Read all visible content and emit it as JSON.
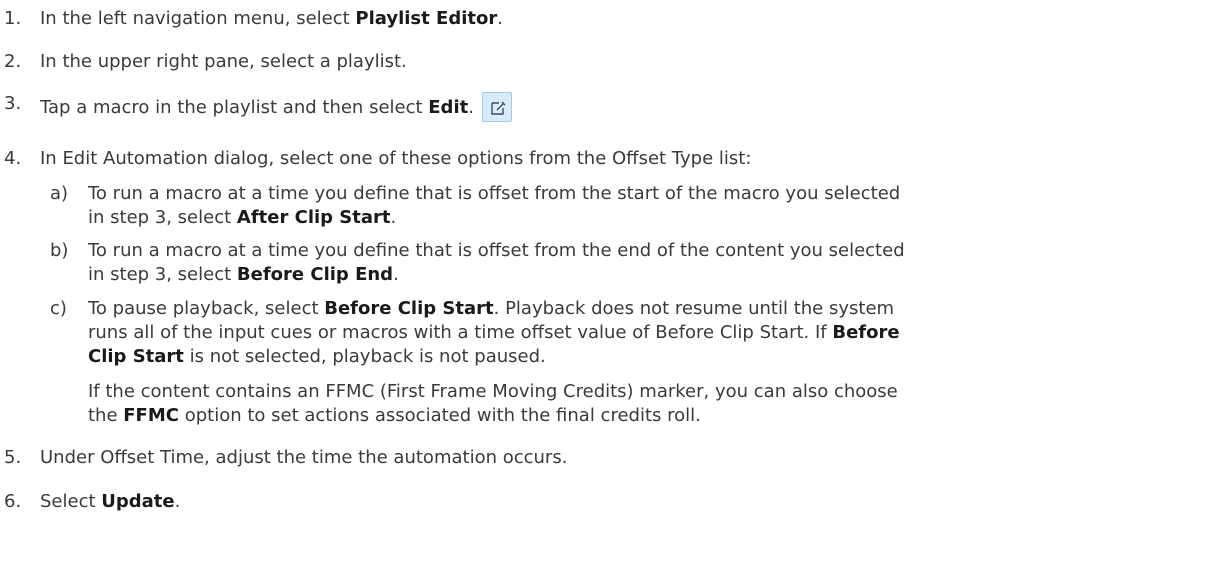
{
  "steps": [
    {
      "num": "1.",
      "pre": "In the left navigation menu, select ",
      "bold": "Playlist Editor",
      "post": "."
    },
    {
      "num": "2.",
      "text": "In the upper right pane, select a playlist."
    },
    {
      "num": "3.",
      "pre": "Tap a macro in the playlist and then select ",
      "bold": "Edit",
      "post": "."
    },
    {
      "num": "4.",
      "text": "In Edit Automation dialog, select one of these options from the Offset Type list:"
    },
    {
      "num": "5.",
      "text": "Under Offset Time, adjust the time the automation occurs."
    },
    {
      "num": "6.",
      "pre": "Select ",
      "bold": "Update",
      "post": "."
    }
  ],
  "suboptions": {
    "a": {
      "label": "a)",
      "line1": "To run a macro at a time you define that is offset from the start of the macro you selected",
      "line2_pre": "in step 3, select ",
      "line2_bold": "After Clip Start",
      "line2_post": "."
    },
    "b": {
      "label": "b)",
      "line1": "To run a macro at a time you define that is offset from the end of the content you selected",
      "line2_pre": "in step 3, select ",
      "line2_bold": "Before Clip End",
      "line2_post": "."
    },
    "c": {
      "label": "c)",
      "line1_pre": "To pause playback, select ",
      "line1_bold": "Before Clip Start",
      "line1_post": ". Playback does not resume until the system",
      "line2_pre": "runs all of the input cues or macros with a time offset value of Before Clip Start. If ",
      "line2_bold": "Before",
      "line3_bold": "Clip Start",
      "line3_post": " is not selected, playback is not paused.",
      "note1": "If the content contains an FFMC (First Frame Moving Credits) marker, you can also choose",
      "note2_pre": "the ",
      "note2_bold": "FFMC",
      "note2_post": " option to set actions associated with the final credits roll."
    }
  },
  "icons": {
    "edit": "edit-icon"
  }
}
